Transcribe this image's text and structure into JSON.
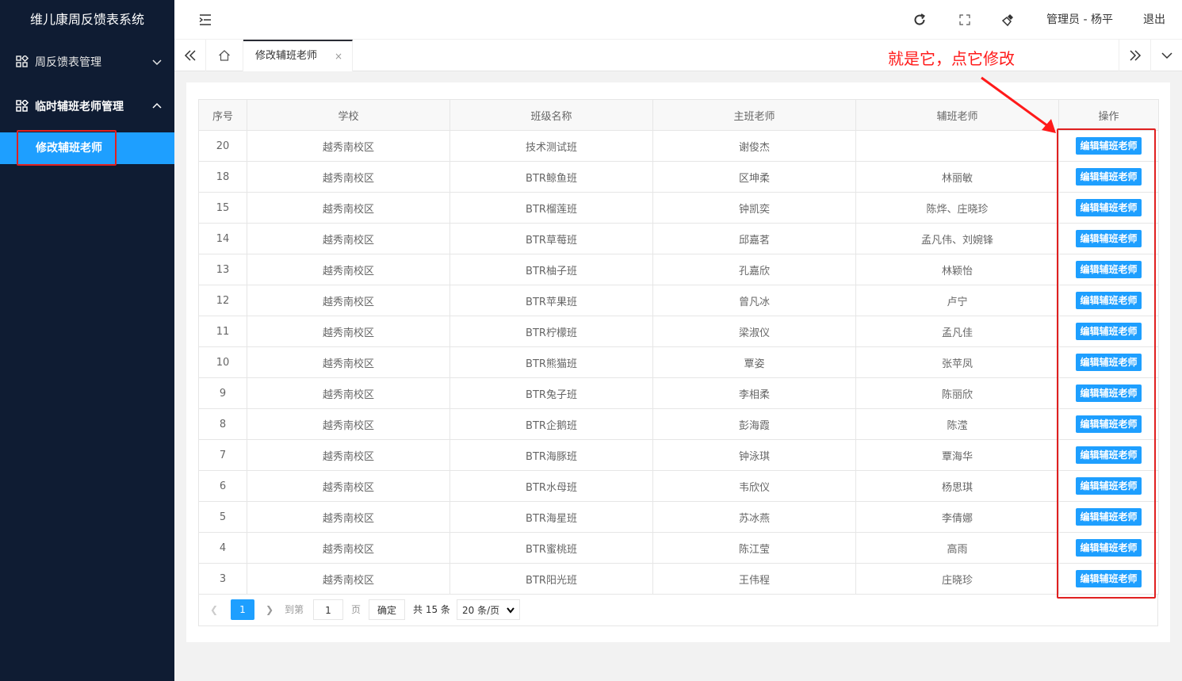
{
  "app": {
    "title": "维儿康周反馈表系统"
  },
  "sidebar": {
    "groups": [
      {
        "label": "周反馈表管理"
      },
      {
        "label": "临时辅班老师管理"
      }
    ],
    "active_item": "修改辅班老师"
  },
  "header": {
    "user": "管理员 - 杨平",
    "logout": "退出"
  },
  "tabs": {
    "active_tab": "修改辅班老师",
    "close_glyph": "×"
  },
  "annotation": "就是它，点它修改",
  "table": {
    "columns": [
      "序号",
      "学校",
      "班级名称",
      "主班老师",
      "辅班老师",
      "操作"
    ],
    "action_label": "编辑辅班老师",
    "rows": [
      [
        "20",
        "越秀南校区",
        "技术测试班",
        "谢俊杰",
        ""
      ],
      [
        "18",
        "越秀南校区",
        "BTR鲸鱼班",
        "区坤柔",
        "林丽敏"
      ],
      [
        "15",
        "越秀南校区",
        "BTR榴莲班",
        "钟凯奕",
        "陈烨、庄晓珍"
      ],
      [
        "14",
        "越秀南校区",
        "BTR草莓班",
        "邱嘉茗",
        "孟凡伟、刘婉锋"
      ],
      [
        "13",
        "越秀南校区",
        "BTR柚子班",
        "孔嘉欣",
        "林颖怡"
      ],
      [
        "12",
        "越秀南校区",
        "BTR苹果班",
        "曾凡冰",
        "卢宁"
      ],
      [
        "11",
        "越秀南校区",
        "BTR柠檬班",
        "梁淑仪",
        "孟凡佳"
      ],
      [
        "10",
        "越秀南校区",
        "BTR熊猫班",
        "覃姿",
        "张苹凤"
      ],
      [
        "9",
        "越秀南校区",
        "BTR兔子班",
        "李相柔",
        "陈丽欣"
      ],
      [
        "8",
        "越秀南校区",
        "BTR企鹅班",
        "彭海霞",
        "陈滢"
      ],
      [
        "7",
        "越秀南校区",
        "BTR海豚班",
        "钟泳琪",
        "覃海华"
      ],
      [
        "6",
        "越秀南校区",
        "BTR水母班",
        "韦欣仪",
        "杨思琪"
      ],
      [
        "5",
        "越秀南校区",
        "BTR海星班",
        "苏冰燕",
        "李倩娜"
      ],
      [
        "4",
        "越秀南校区",
        "BTR蜜桃班",
        "陈江莹",
        "高雨"
      ],
      [
        "3",
        "越秀南校区",
        "BTR阳光班",
        "王伟程",
        "庄晓珍"
      ]
    ]
  },
  "pager": {
    "current_page": "1",
    "goto_prefix": "到第",
    "goto_value": "1",
    "goto_suffix": "页",
    "confirm": "确定",
    "total": "共 15 条",
    "page_size": "20 条/页"
  },
  "colors": {
    "accent": "#1e9fff",
    "sidebar": "#0f1c33",
    "annotation": "#ff1a1a"
  }
}
